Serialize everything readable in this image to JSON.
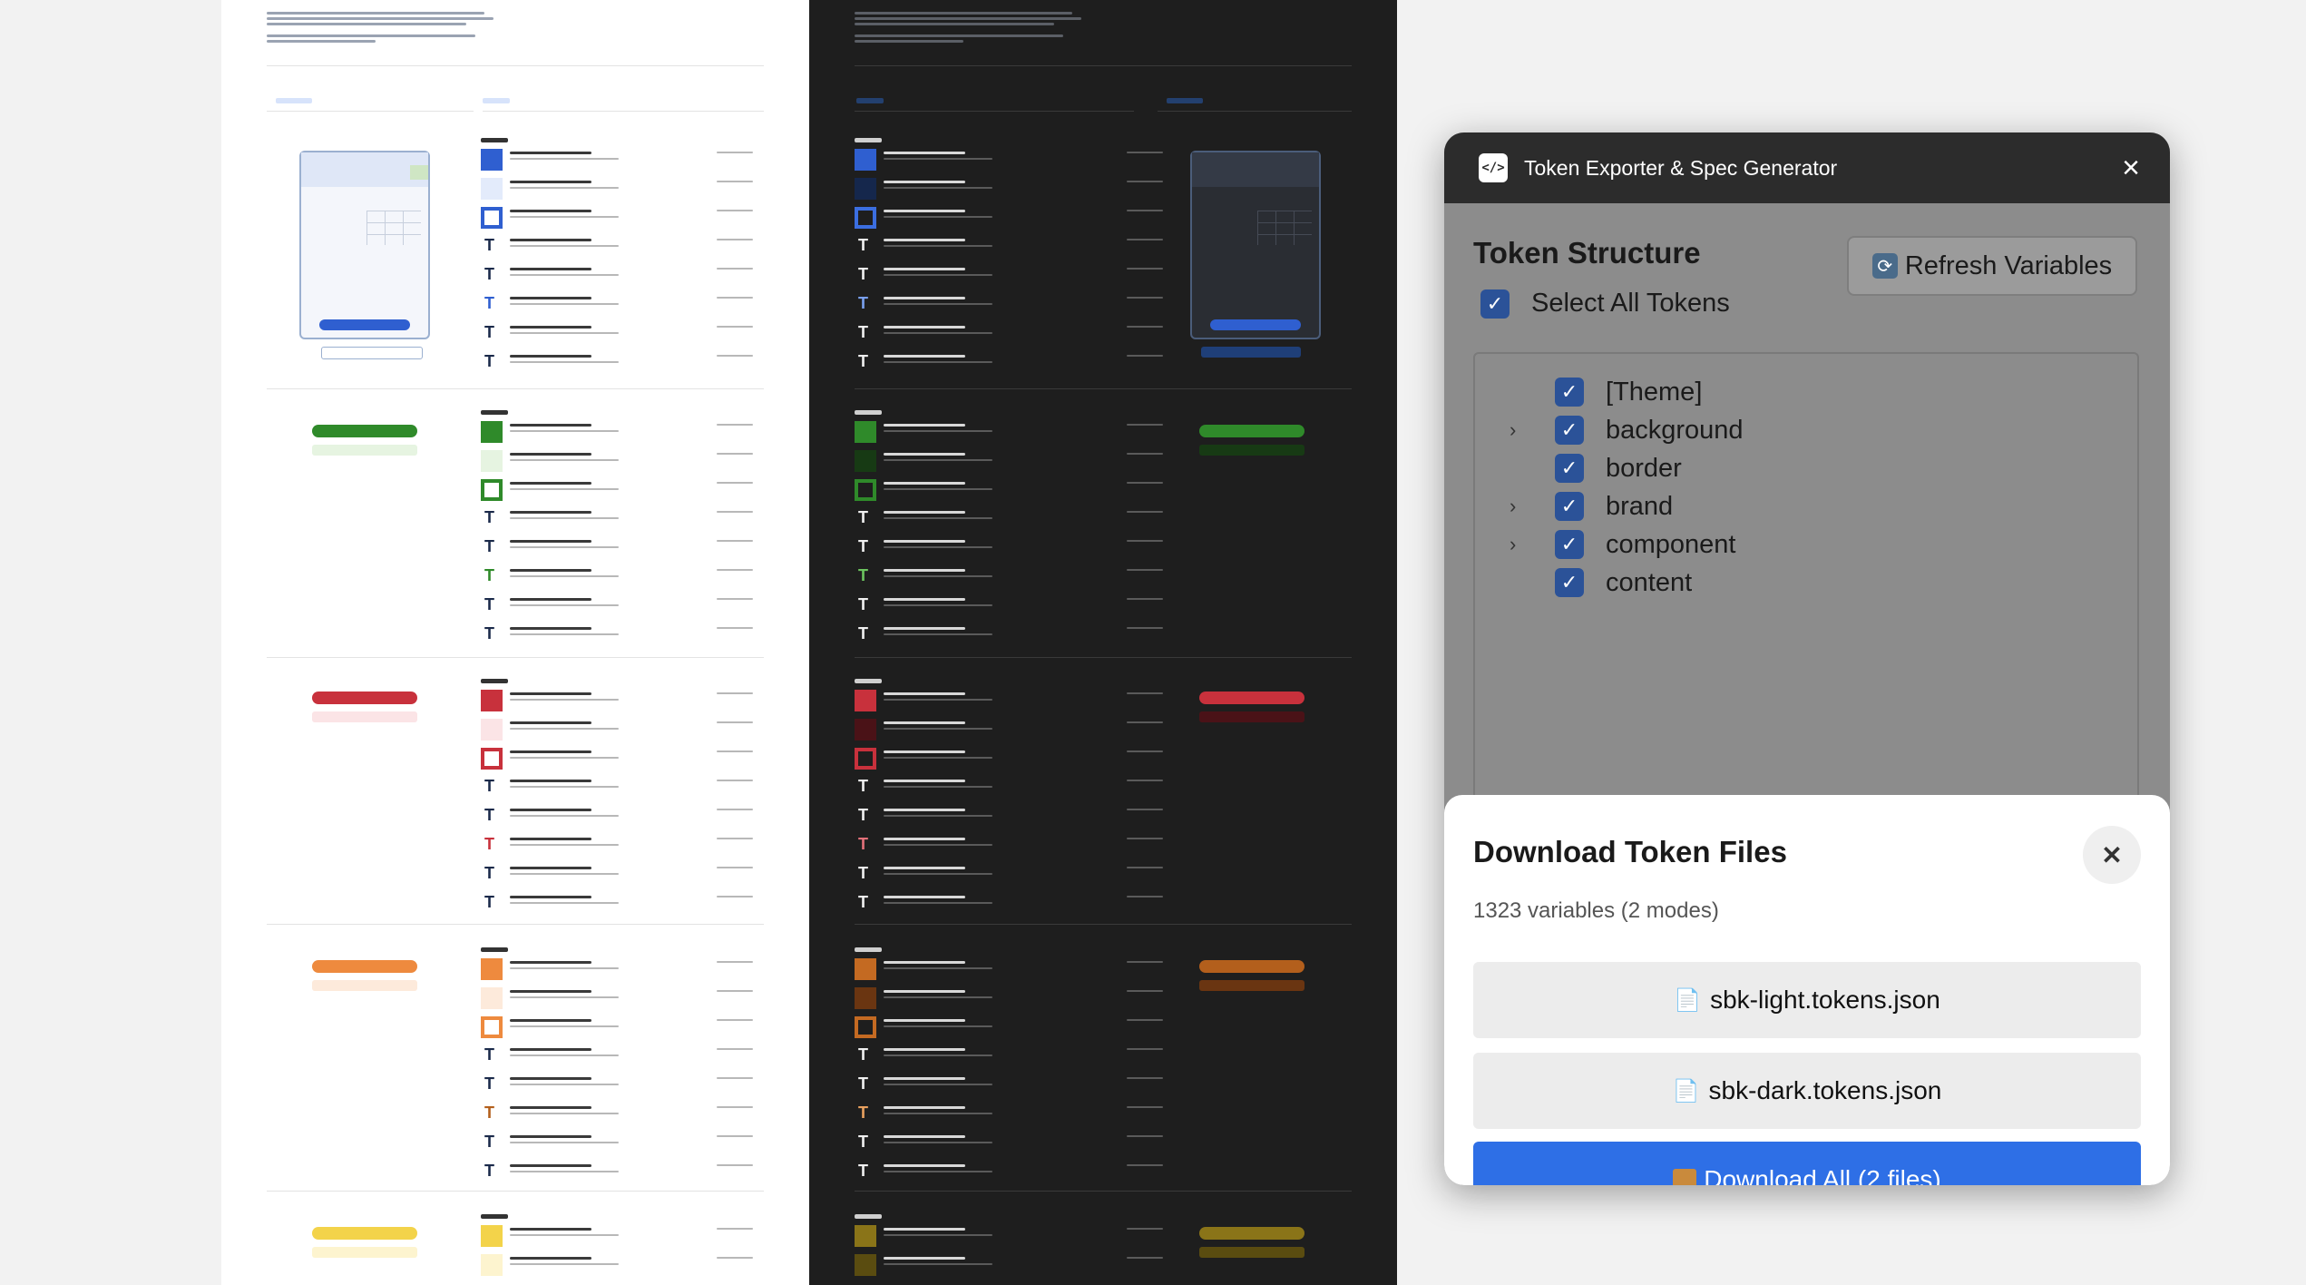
{
  "plugin": {
    "title": "Token Exporter & Spec Generator",
    "icon": "code-icon",
    "structure_title": "Token Structure",
    "refresh_label": "Refresh Variables",
    "select_all_label": "Select All Tokens",
    "tree": [
      {
        "label": "[Theme]",
        "expandable": false,
        "checked": true
      },
      {
        "label": "background",
        "expandable": true,
        "checked": true
      },
      {
        "label": "border",
        "expandable": false,
        "checked": true
      },
      {
        "label": "brand",
        "expandable": true,
        "checked": true
      },
      {
        "label": "component",
        "expandable": true,
        "checked": true
      },
      {
        "label": "content",
        "expandable": false,
        "checked": true
      }
    ]
  },
  "modal": {
    "title": "Download Token Files",
    "summary": "1323 variables (2 modes)",
    "files": [
      {
        "label": "sbk-light.tokens.json"
      },
      {
        "label": "sbk-dark.tokens.json"
      }
    ],
    "download_all_label": "Download All (2 files)"
  },
  "colors": {
    "accent": "#2e6fe6",
    "checkbox": "#2b5298",
    "header": "#2c2c2c",
    "info": "#2f5fd0",
    "positive": "#2f8a2a",
    "important": "#c8313c",
    "warning": "#ee8a3e",
    "alert": "#f3d34a"
  }
}
